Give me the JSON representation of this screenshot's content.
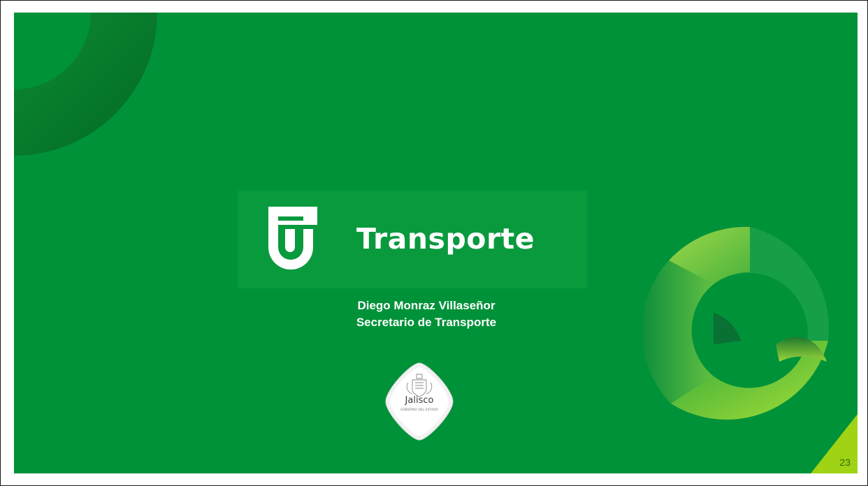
{
  "slide": {
    "brand": {
      "wordmark": "Transporte"
    },
    "speaker": {
      "name": "Diego Monraz Villaseñor",
      "title": "Secretario de Transporte"
    },
    "seal": {
      "wordmark": "Jalisco",
      "subtitle": "GOBIERNO DEL ESTADO"
    },
    "page_number": "23",
    "colors": {
      "background": "#009239",
      "light_green": "#8fd44a",
      "dark_green": "#006f2b",
      "accent_lime": "#9fd313"
    },
    "icons": [
      "transporte-logo-icon",
      "jalisco-seal-icon"
    ]
  }
}
